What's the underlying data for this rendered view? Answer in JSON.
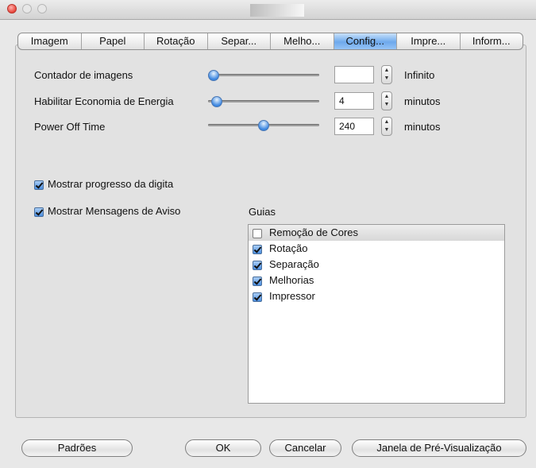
{
  "tabs": [
    "Imagem",
    "Papel",
    "Rotação",
    "Separ...",
    "Melho...",
    "Config...",
    "Impre...",
    "Inform..."
  ],
  "selected_tab": "Config...",
  "settings": {
    "image_counter": {
      "label": "Contador de imagens",
      "value": "",
      "unit": "Infinito",
      "slider_level": 0.0
    },
    "energy_saving": {
      "label": "Habilitar Economia de Energia",
      "value": "4",
      "unit": "minutos",
      "slider_level": 0.03
    },
    "power_off": {
      "label": "Power Off Time",
      "value": "240",
      "unit": "minutos",
      "slider_level": 0.5
    }
  },
  "options": {
    "show_progress": {
      "label": "Mostrar progresso da digita",
      "checked": true
    },
    "show_warnings": {
      "label": "Mostrar Mensagens de Aviso",
      "checked": true
    }
  },
  "guides": {
    "label": "Guias",
    "items": [
      {
        "label": "Remoção de Cores",
        "checked": false
      },
      {
        "label": "Rotação",
        "checked": true
      },
      {
        "label": "Separação",
        "checked": true
      },
      {
        "label": "Melhorias",
        "checked": true
      },
      {
        "label": "Impressor",
        "checked": true
      }
    ]
  },
  "buttons": {
    "defaults": "Padrões",
    "ok": "OK",
    "cancel": "Cancelar",
    "preview": "Janela de Pré-Visualização"
  },
  "icons": {
    "stepper_up": "triangle-up",
    "stepper_down": "triangle-down",
    "checkbox": "checkmark"
  },
  "colors": {
    "selected_tab": "#6ea9ec",
    "close_button": "#e9443a",
    "slider_knob": "#3b86e0"
  }
}
